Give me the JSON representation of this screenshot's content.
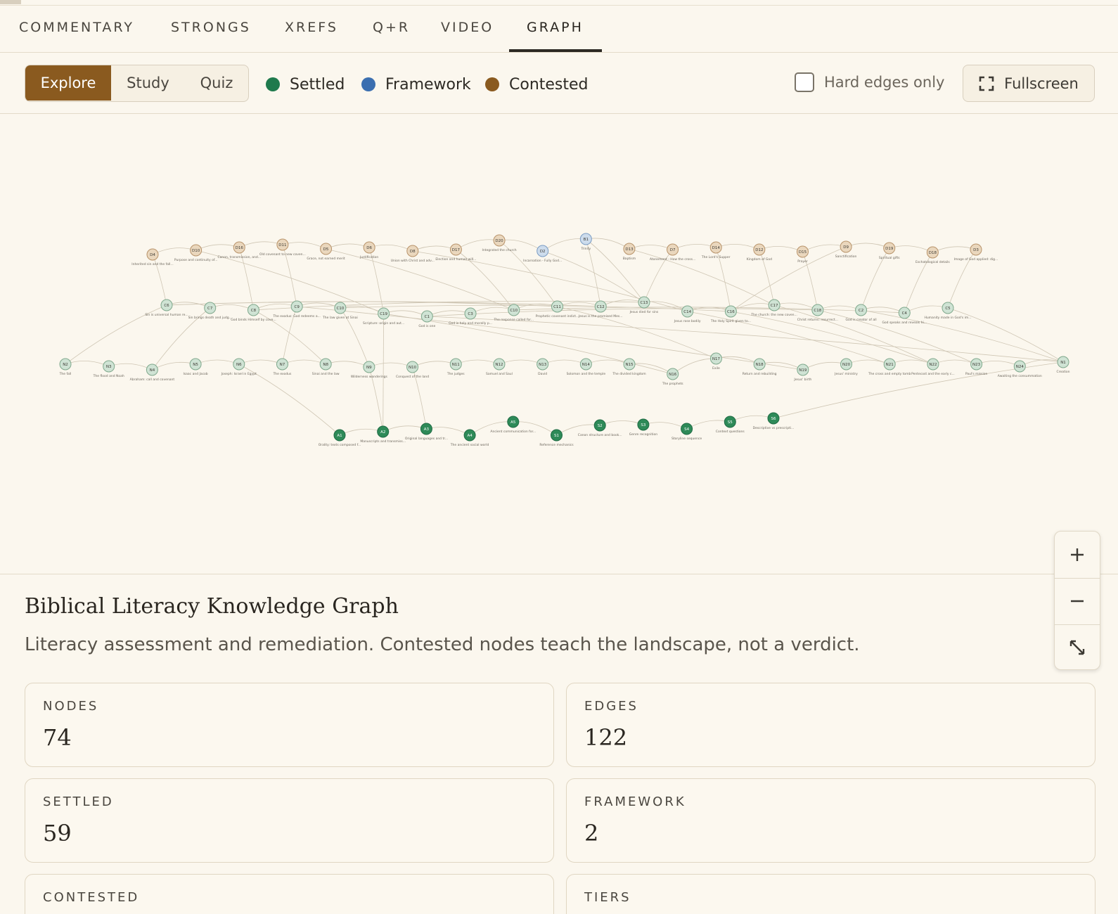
{
  "tabs": [
    {
      "label": "COMMENTARY"
    },
    {
      "label": "STRONGS"
    },
    {
      "label": "XREFS"
    },
    {
      "label": "Q+R"
    },
    {
      "label": "VIDEO"
    },
    {
      "label": "GRAPH",
      "active": true
    }
  ],
  "toolbar": {
    "modes": [
      {
        "label": "Explore",
        "active": true
      },
      {
        "label": "Study"
      },
      {
        "label": "Quiz"
      }
    ],
    "legend": [
      {
        "label": "Settled",
        "color": "#1f7a4d"
      },
      {
        "label": "Framework",
        "color": "#3b6fb0"
      },
      {
        "label": "Contested",
        "color": "#8a5a1f"
      }
    ],
    "hard_edges_label": "Hard edges only",
    "hard_edges_checked": false,
    "fullscreen_label": "Fullscreen"
  },
  "graph": {
    "node_colors": {
      "settled_fill": "#cfe3d4",
      "framework_fill": "#cddcec",
      "contested_fill": "#ead7bd",
      "settled_dark": "#2e8a58"
    },
    "rows": [
      {
        "kind": "contested",
        "nodes": [
          {
            "id": "D4",
            "label": "Inherited sin and the fall..."
          },
          {
            "id": "D10",
            "label": "Purpose and continuity of..."
          },
          {
            "id": "D16",
            "label": "Canon, transmission, and..."
          },
          {
            "id": "D11",
            "label": "Old covenant to new coven..."
          },
          {
            "id": "D5",
            "label": "Grace, not earned merit"
          },
          {
            "id": "D6",
            "label": "Justification"
          },
          {
            "id": "D8",
            "label": "Union with Christ and adv..."
          },
          {
            "id": "D17",
            "label": "Election and human will..."
          },
          {
            "id": "D20",
            "label": "Integrated the church"
          },
          {
            "id": "D2",
            "label": "Incarnation - Fully God..."
          },
          {
            "id": "B1",
            "label": "Trinity"
          },
          {
            "id": "D13",
            "label": "Baptism"
          },
          {
            "id": "D7",
            "label": "Atonement - How the cross..."
          },
          {
            "id": "D14",
            "label": "The Lord's Supper"
          },
          {
            "id": "D12",
            "label": "Kingdom of God"
          },
          {
            "id": "D15",
            "label": "Prayer"
          },
          {
            "id": "D9",
            "label": "Sanctification"
          },
          {
            "id": "D19",
            "label": "Spiritual gifts"
          },
          {
            "id": "D18",
            "label": "Eschatological details"
          },
          {
            "id": "D3",
            "label": "Image of God applied: dig..."
          }
        ]
      },
      {
        "kind": "settled",
        "nodes": [
          {
            "id": "C6",
            "label": "Sin is universal human re..."
          },
          {
            "id": "C7",
            "label": "Sin brings death and judg..."
          },
          {
            "id": "C8",
            "label": "God binds Himself by cove..."
          },
          {
            "id": "C9",
            "label": "The exodus: God redeems a..."
          },
          {
            "id": "C10",
            "label": "The law given at Sinai"
          },
          {
            "id": "C19",
            "label": "Scripture: origin and aut..."
          },
          {
            "id": "C1",
            "label": "God is one"
          },
          {
            "id": "C3",
            "label": "God is holy and morally p..."
          },
          {
            "id": "C10",
            "label": "The response called for..."
          },
          {
            "id": "C11",
            "label": "Prophetic covenant indict..."
          },
          {
            "id": "C12",
            "label": "Jesus is the promised Mes..."
          },
          {
            "id": "C13",
            "label": "Jesus died for sins"
          },
          {
            "id": "C14",
            "label": "Jesus rose bodily"
          },
          {
            "id": "C16",
            "label": "The Holy Spirit given to..."
          },
          {
            "id": "C17",
            "label": "The church: the new coven..."
          },
          {
            "id": "C18",
            "label": "Christ returns: resurrect..."
          },
          {
            "id": "C2",
            "label": "God is creator of all"
          },
          {
            "id": "C4",
            "label": "God speaks and reveals hi..."
          },
          {
            "id": "C5",
            "label": "Humanity made in God's im..."
          }
        ]
      },
      {
        "kind": "settled",
        "nodes": [
          {
            "id": "N2",
            "label": "The fall"
          },
          {
            "id": "N3",
            "label": "The flood and Noah"
          },
          {
            "id": "N4",
            "label": "Abraham: call and covenant"
          },
          {
            "id": "N5",
            "label": "Isaac and Jacob"
          },
          {
            "id": "N6",
            "label": "Joseph: Israel in Egypt"
          },
          {
            "id": "N7",
            "label": "The exodus"
          },
          {
            "id": "N8",
            "label": "Sinai and the law"
          },
          {
            "id": "N9",
            "label": "Wilderness wanderings"
          },
          {
            "id": "N10",
            "label": "Conquest of the land"
          },
          {
            "id": "N11",
            "label": "The judges"
          },
          {
            "id": "N12",
            "label": "Samuel and Saul"
          },
          {
            "id": "N13",
            "label": "David"
          },
          {
            "id": "N14",
            "label": "Solomon and the temple"
          },
          {
            "id": "N15",
            "label": "The divided kingdom"
          },
          {
            "id": "N16",
            "label": "The prophets"
          },
          {
            "id": "N17",
            "label": "Exile"
          },
          {
            "id": "N18",
            "label": "Return and rebuilding"
          },
          {
            "id": "N19",
            "label": "Jesus' birth"
          },
          {
            "id": "N20",
            "label": "Jesus' ministry"
          },
          {
            "id": "N21",
            "label": "The cross and empty tomb"
          },
          {
            "id": "N22",
            "label": "Pentecost and the early c..."
          },
          {
            "id": "N23",
            "label": "Paul's mission"
          },
          {
            "id": "N24",
            "label": "Awaiting the consummation"
          },
          {
            "id": "N1",
            "label": "Creation"
          }
        ]
      },
      {
        "kind": "settled-dark",
        "nodes": [
          {
            "id": "A1",
            "label": "Orality: texts composed f..."
          },
          {
            "id": "A2",
            "label": "Manuscripts and transmiss..."
          },
          {
            "id": "A3",
            "label": "Original languages and tr..."
          },
          {
            "id": "A4",
            "label": "The ancient social world"
          },
          {
            "id": "A5",
            "label": "Ancient communication for..."
          },
          {
            "id": "S1",
            "label": "Reference mechanics"
          },
          {
            "id": "S2",
            "label": "Canon structure and book..."
          },
          {
            "id": "S3",
            "label": "Genre recognition"
          },
          {
            "id": "S4",
            "label": "Storyline sequence"
          },
          {
            "id": "S5",
            "label": "Context questions"
          },
          {
            "id": "S6",
            "label": "Descriptive vs prescripti..."
          }
        ]
      }
    ]
  },
  "info": {
    "title": "Biblical Literacy Knowledge Graph",
    "subtitle": "Literacy assessment and remediation. Contested nodes teach the landscape, not a verdict."
  },
  "stats": [
    {
      "label": "NODES",
      "value": "74"
    },
    {
      "label": "EDGES",
      "value": "122"
    },
    {
      "label": "SETTLED",
      "value": "59"
    },
    {
      "label": "FRAMEWORK",
      "value": "2"
    },
    {
      "label": "CONTESTED",
      "value": ""
    },
    {
      "label": "TIERS",
      "value": ""
    }
  ]
}
